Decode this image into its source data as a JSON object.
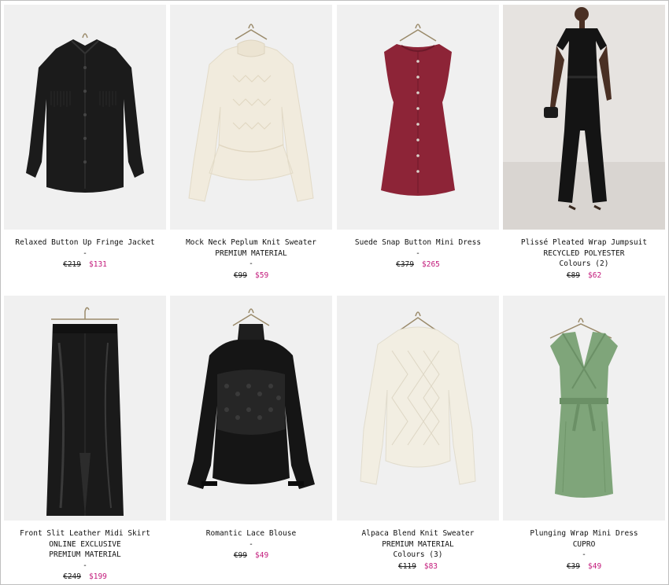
{
  "products": [
    {
      "name": "Relaxed Button Up Fringe Jacket",
      "badges": [],
      "colours": "",
      "dash": "-",
      "old_price": "€219",
      "sale_price": "$131",
      "image": "black-fringe-jacket"
    },
    {
      "name": "Mock Neck Peplum Knit Sweater",
      "badges": [
        "PREMIUM MATERIAL"
      ],
      "colours": "",
      "dash": "-",
      "old_price": "€99",
      "sale_price": "$59",
      "image": "cream-peplum-knit"
    },
    {
      "name": "Suede Snap Button Mini Dress",
      "badges": [],
      "colours": "",
      "dash": "-",
      "old_price": "€379",
      "sale_price": "$265",
      "image": "burgundy-suede-dress"
    },
    {
      "name": "Plissé Pleated Wrap Jumpsuit",
      "badges": [
        "RECYCLED POLYESTER"
      ],
      "colours": "Colours (2)",
      "dash": "",
      "old_price": "€89",
      "sale_price": "$62",
      "image": "black-jumpsuit-model"
    },
    {
      "name": "Front Slit Leather Midi Skirt",
      "badges": [
        "ONLINE EXCLUSIVE",
        "PREMIUM MATERIAL"
      ],
      "colours": "",
      "dash": "-",
      "old_price": "€249",
      "sale_price": "$199",
      "image": "black-leather-skirt"
    },
    {
      "name": "Romantic Lace Blouse",
      "badges": [],
      "colours": "",
      "dash": "-",
      "old_price": "€99",
      "sale_price": "$49",
      "image": "black-lace-blouse"
    },
    {
      "name": "Alpaca Blend Knit Sweater",
      "badges": [
        "PREMIUM MATERIAL"
      ],
      "colours": "Colours (3)",
      "dash": "",
      "old_price": "€119",
      "sale_price": "$83",
      "image": "cream-alpaca-knit"
    },
    {
      "name": "Plunging Wrap Mini Dress",
      "badges": [
        "CUPRO"
      ],
      "colours": "",
      "dash": "-",
      "old_price": "€39",
      "sale_price": "$49",
      "image": "green-wrap-dress"
    }
  ],
  "colors": {
    "sale": "#c2187a",
    "image_bg": "#f0f0f0",
    "text": "#111111"
  }
}
